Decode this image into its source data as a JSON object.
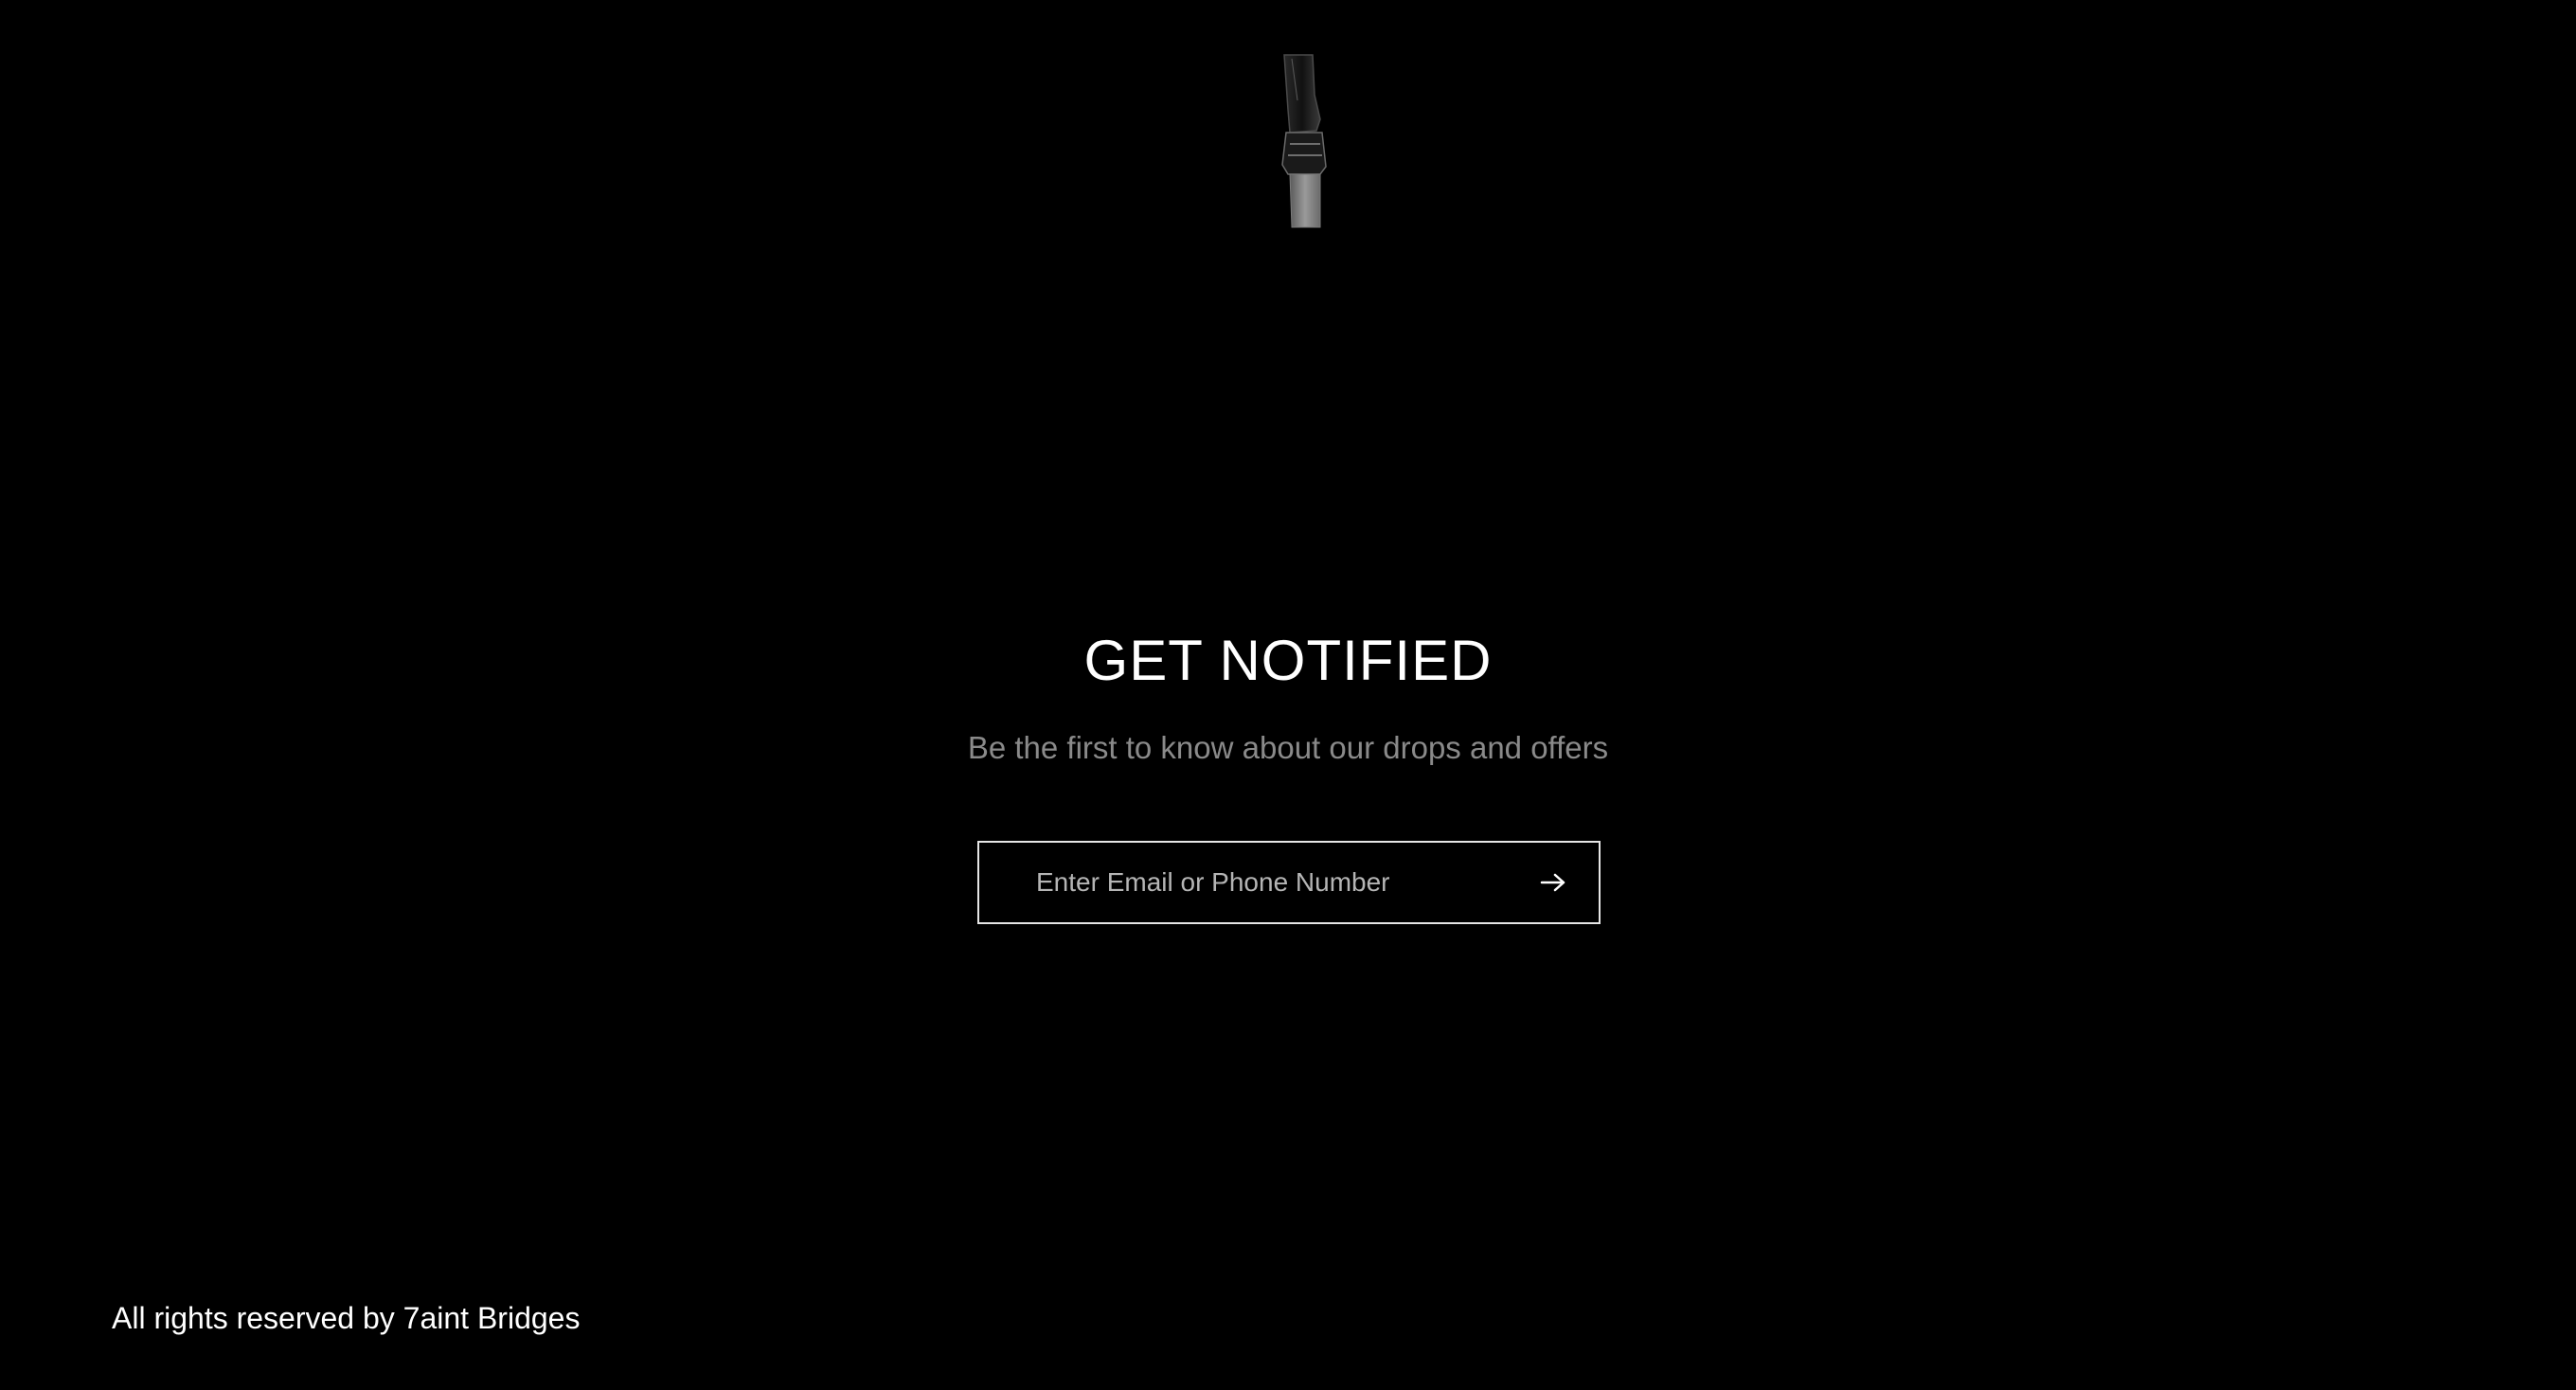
{
  "brand": {
    "logo_icon": "hanging-clip-logo-icon"
  },
  "hero": {
    "title": "GET NOTIFIED",
    "subtitle": "Be the first to know about our drops and offers"
  },
  "signup": {
    "input_value": "",
    "placeholder": "Enter Email or Phone Number",
    "submit_icon": "arrow-right-icon"
  },
  "footer": {
    "copyright": "All rights reserved by 7aint Bridges"
  },
  "colors": {
    "background": "#000000",
    "text": "#ffffff",
    "muted_text": "#8a8a8a",
    "input_border": "#e6e6e6"
  }
}
